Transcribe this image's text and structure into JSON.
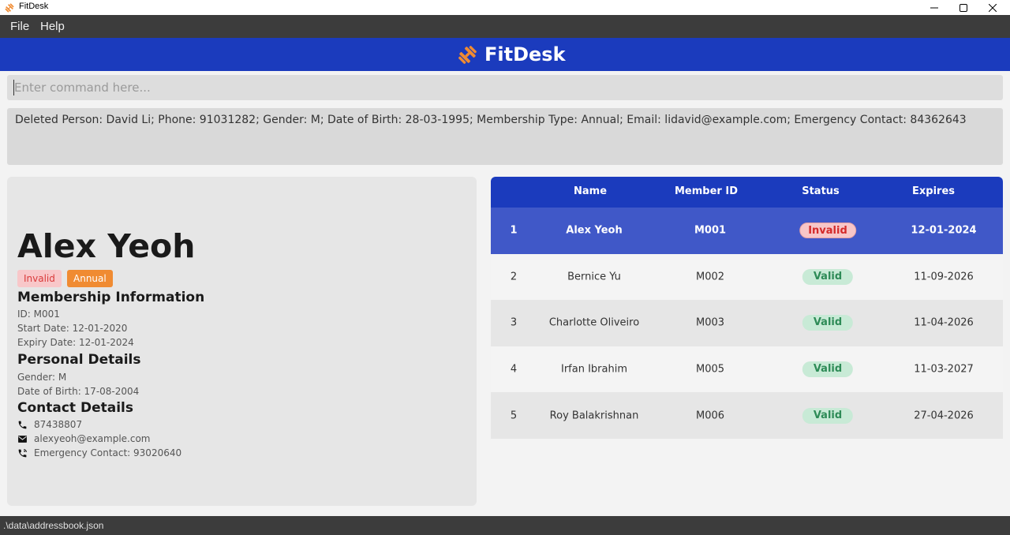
{
  "window": {
    "title": "FitDesk"
  },
  "menu": {
    "file": "File",
    "help": "Help"
  },
  "header": {
    "brand": "FitDesk"
  },
  "command": {
    "placeholder": "Enter command here...",
    "value": ""
  },
  "result": {
    "text": "Deleted Person: David Li; Phone: 91031282; Gender: M; Date of Birth: 28-03-1995; Membership Type: Annual; Email: lidavid@example.com; Emergency Contact: 84362643"
  },
  "detail": {
    "name": "Alex Yeoh",
    "tags": {
      "status": "Invalid",
      "membership": "Annual"
    },
    "membership_heading": "Membership Information",
    "id": "ID: M001",
    "start_date": "Start Date: 12-01-2020",
    "expiry_date": "Expiry Date: 12-01-2024",
    "personal_heading": "Personal Details",
    "gender": "Gender: M",
    "dob": "Date of Birth: 17-08-2004",
    "contact_heading": "Contact Details",
    "phone": "87438807",
    "email": "alexyeoh@example.com",
    "emergency": "Emergency Contact: 93020640"
  },
  "table": {
    "headers": {
      "name": "Name",
      "member_id": "Member ID",
      "status": "Status",
      "expires": "Expires"
    },
    "rows": [
      {
        "index": "1",
        "name": "Alex Yeoh",
        "member_id": "M001",
        "status": "Invalid",
        "expires": "12-01-2024"
      },
      {
        "index": "2",
        "name": "Bernice Yu",
        "member_id": "M002",
        "status": "Valid",
        "expires": "11-09-2026"
      },
      {
        "index": "3",
        "name": "Charlotte Oliveiro",
        "member_id": "M003",
        "status": "Valid",
        "expires": "11-04-2026"
      },
      {
        "index": "4",
        "name": "Irfan Ibrahim",
        "member_id": "M005",
        "status": "Valid",
        "expires": "11-03-2027"
      },
      {
        "index": "5",
        "name": "Roy Balakrishnan",
        "member_id": "M006",
        "status": "Valid",
        "expires": "27-04-2026"
      }
    ]
  },
  "statusbar": {
    "path": ".\\data\\addressbook.json"
  },
  "colors": {
    "brand_blue": "#1b3bbd",
    "selected_row": "#4058c8",
    "accent_orange": "#f08b32",
    "invalid_red": "#d42a2a",
    "valid_green": "#2e8b57"
  }
}
